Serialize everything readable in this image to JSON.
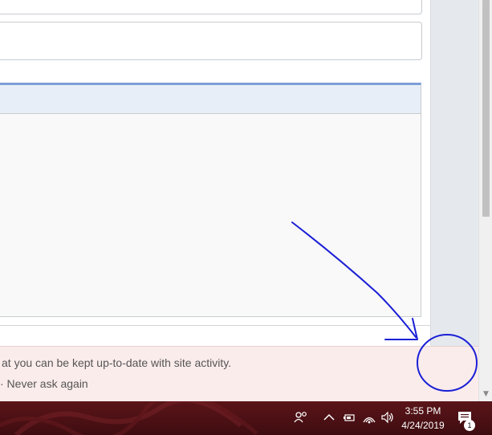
{
  "notification": {
    "message": "at you can be kept up-to-date with site activity.",
    "action": "· Never ask again"
  },
  "taskbar": {
    "time": "3:55 PM",
    "date": "4/24/2019",
    "notifications_count": "1",
    "icons": [
      "people-icon",
      "chevron-up-icon",
      "battery-icon",
      "wifi-icon",
      "volume-icon",
      "action-center-icon"
    ]
  },
  "colors": {
    "taskbar": "#4a1014",
    "notice_bg": "#fbecec",
    "annotation": "#1a1fd6",
    "card_accent": "#7b9ed8"
  }
}
